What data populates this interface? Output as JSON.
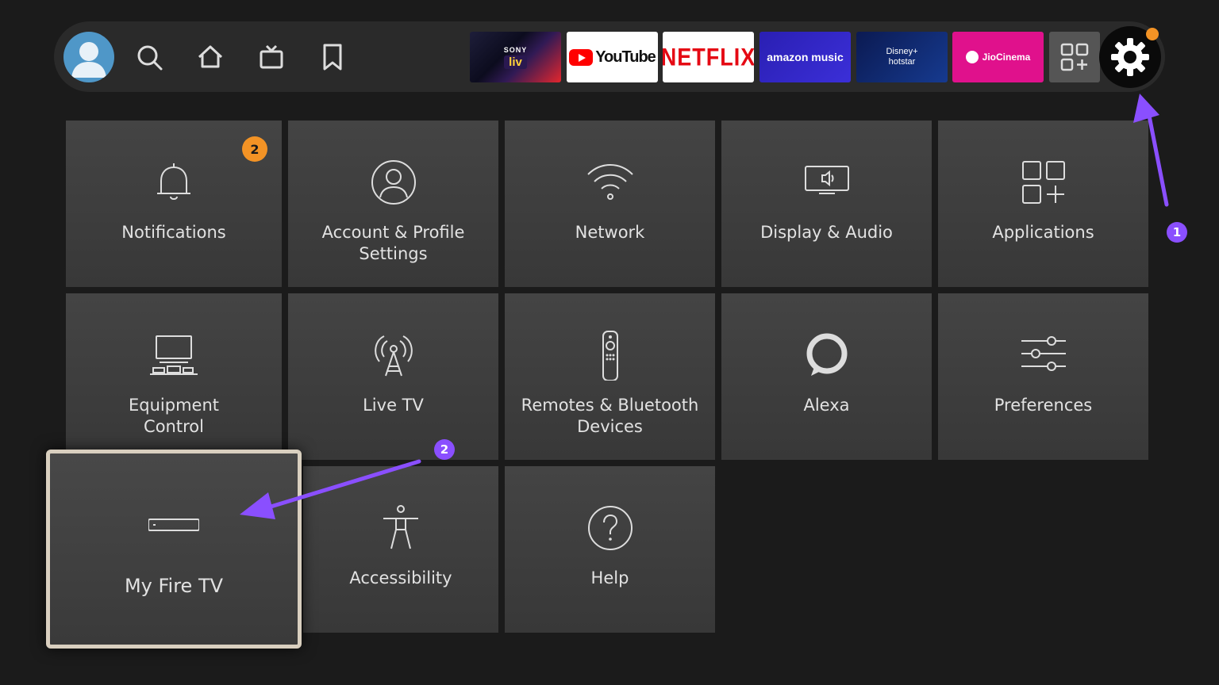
{
  "navbar": {
    "apps": [
      {
        "line1": "SONY",
        "line2": "liv"
      },
      {
        "label": "YouTube"
      },
      {
        "label": "NETFLIX"
      },
      {
        "label": "amazon music"
      },
      {
        "line1": "Disney+",
        "line2": "hotstar"
      },
      {
        "label": "JioCinema"
      }
    ]
  },
  "settings": {
    "tiles": [
      {
        "label": "Notifications",
        "icon": "bell-icon",
        "badge": "2"
      },
      {
        "label": "Account & Profile Settings",
        "icon": "user-icon"
      },
      {
        "label": "Network",
        "icon": "wifi-icon"
      },
      {
        "label": "Display & Audio",
        "icon": "display-speaker-icon"
      },
      {
        "label": "Applications",
        "icon": "apps-icon"
      },
      {
        "label": "Equipment Control",
        "icon": "equipment-icon"
      },
      {
        "label": "Live TV",
        "icon": "antenna-icon"
      },
      {
        "label": "Remotes & Bluetooth Devices",
        "icon": "remote-icon"
      },
      {
        "label": "Alexa",
        "icon": "alexa-icon"
      },
      {
        "label": "Preferences",
        "icon": "sliders-icon"
      },
      {
        "label": "My Fire TV",
        "icon": "firetv-device-icon"
      },
      {
        "label": "Accessibility",
        "icon": "accessibility-icon"
      },
      {
        "label": "Help",
        "icon": "help-icon"
      }
    ]
  },
  "annotations": {
    "marker1": "1",
    "marker2": "2",
    "color": "#8a4fff"
  },
  "colors": {
    "badge": "#f39325",
    "focus_border": "#d9cfbf"
  }
}
